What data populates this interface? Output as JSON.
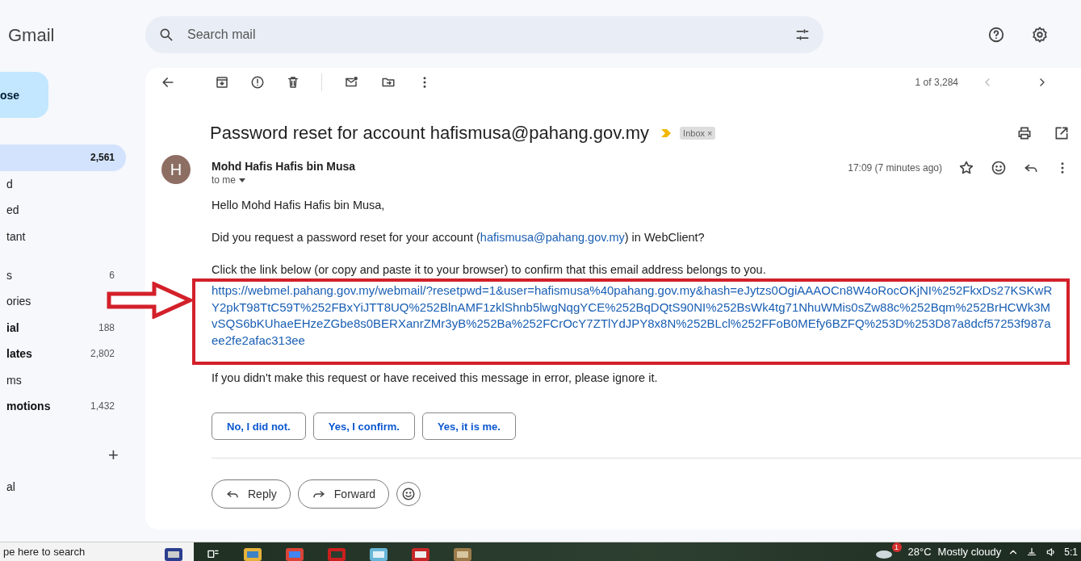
{
  "app": {
    "name": "Gmail"
  },
  "search": {
    "placeholder": "Search mail"
  },
  "compose": {
    "label": "ose"
  },
  "sidebar": {
    "items": [
      {
        "count": "2,561",
        "selected": true,
        "unread": true
      },
      {
        "label": "d",
        "selected": false,
        "unread": false
      },
      {
        "label": "ed",
        "selected": false,
        "unread": false
      },
      {
        "label": "tant",
        "selected": false,
        "unread": false
      },
      {
        "label": "s",
        "count": "6",
        "selected": false,
        "unread": false,
        "gap": true
      },
      {
        "label": "ories",
        "selected": false,
        "unread": false
      },
      {
        "label": "ial",
        "count": "188",
        "selected": false,
        "unread": true
      },
      {
        "label": "lates",
        "count": "2,802",
        "selected": false,
        "unread": true
      },
      {
        "label": "ms",
        "selected": false,
        "unread": false
      },
      {
        "label": "motions",
        "count": "1,432",
        "selected": false,
        "unread": true
      }
    ],
    "labels_add": "+",
    "labels": [
      {
        "label": "al"
      }
    ]
  },
  "toolbar": {
    "pager": "1 of 3,284"
  },
  "message": {
    "subject": "Password reset for account hafismusa@pahang.gov.my",
    "important": true,
    "chip": "Inbox",
    "chip_close": "×",
    "sender": "Mohd Hafis Hafis bin Musa",
    "avatar": "H",
    "recipient": "to me",
    "time": "17:09 (7 minutes ago)",
    "greeting": "Hello Mohd Hafis Hafis bin Musa,",
    "question": {
      "before": "Did you request a password reset for your account (",
      "link": "hafismusa@pahang.gov.my",
      "after": ") in WebClient?"
    },
    "instruction": "Click the link below (or copy and paste it to your browser) to confirm that this email address belongs to you.",
    "reset_link": "https://webmel.pahang.gov.my/webmail/?resetpwd=1&user=hafismusa%40pahang.gov.my&hash=eJytzs0OgiAAAOCn8W4oRocOKjNI%252FkxDs27KSKwRY2pkT98TtC59T%252FBxYiJTT8UQ%252BlnAMF1zklShnb5lwgNqgYCE%252BqDQtS90NI%252BsWk4tg71NhuWMis0sZw88c%252Bqm%252BrHCWk3MvSQS6bKUhaeEHzeZGbe8s0BERXanrZMr3yB%252Ba%252FCrOcY7ZTlYdJPY8x8N%252BLcl%252FFoB0MEfy6BZFQ%253D%253D87a8dcf57253f987aee2fe2afac313ee",
    "footer": "If you didn't make this request or have received this message in error, please ignore it.",
    "quick_replies": [
      "No, I did not.",
      "Yes, I confirm.",
      "Yes, it is me."
    ],
    "actions": [
      {
        "kind": "reply",
        "label": "Reply"
      },
      {
        "kind": "forward",
        "label": "Forward"
      }
    ]
  },
  "taskbar": {
    "search": "pe here to search",
    "weather_badge": "1",
    "temperature": "28°C",
    "weather": "Mostly cloudy",
    "clock": "5:1"
  }
}
